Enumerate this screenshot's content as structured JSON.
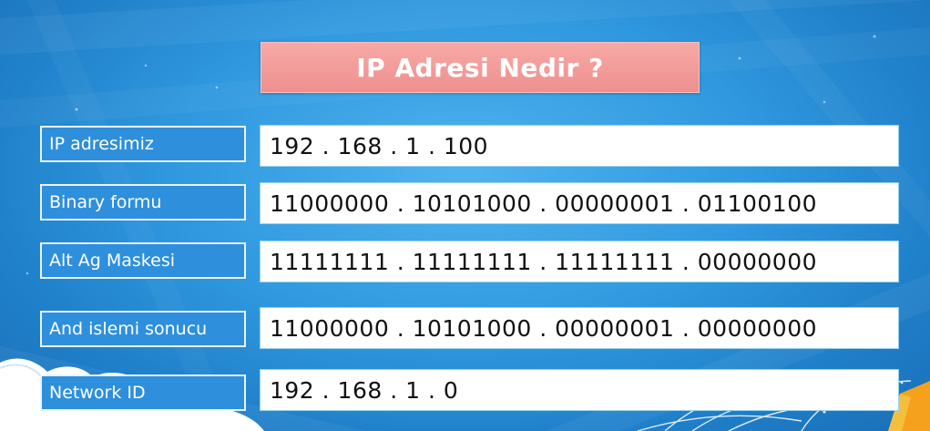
{
  "slide": {
    "title": "IP Adresi Nedir ?",
    "rows": [
      {
        "label": "IP adresimiz",
        "value": "192 . 168 . 1 . 100"
      },
      {
        "label": "Binary formu",
        "value": "11000000 . 10101000 . 00000001 . 01100100"
      },
      {
        "label": "Alt Ag Maskesi",
        "value": "11111111 . 11111111 . 11111111 . 00000000"
      },
      {
        "label": "And islemi sonucu",
        "value": "11000000 . 10101000 . 00000001 . 00000000"
      },
      {
        "label": "Network ID",
        "value": "192 . 168 . 1 . 0"
      }
    ]
  },
  "colors": {
    "background": "#2f98df",
    "title_bar": "#f29a98",
    "label_box": "#2e8fdc",
    "value_box": "#ffffff"
  }
}
